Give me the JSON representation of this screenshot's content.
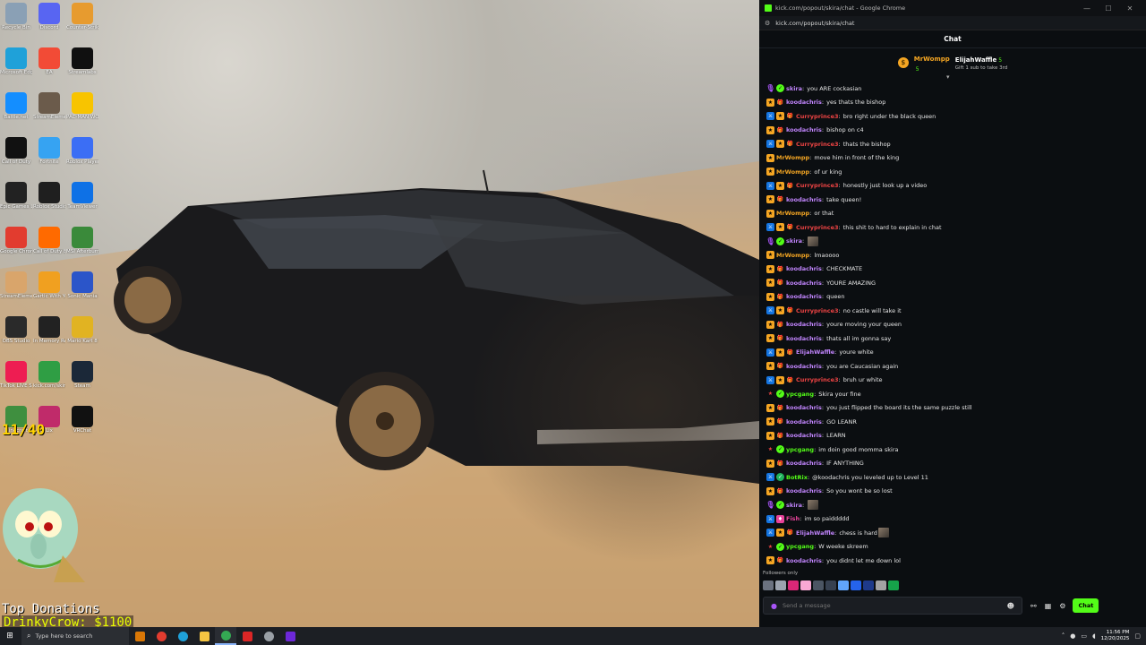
{
  "desktop": {
    "icons": [
      {
        "label": "Recycle Bin",
        "icon": "recycle-bin-icon",
        "color": "#8aa0b5"
      },
      {
        "label": "Discord",
        "icon": "discord-icon",
        "color": "#5865f2"
      },
      {
        "label": "Counter-Strike 2",
        "icon": "counter-strike-icon",
        "color": "#e79b2f"
      },
      {
        "label": "Microsoft Edge",
        "icon": "edge-icon",
        "color": "#1fa1d9"
      },
      {
        "label": "EA",
        "icon": "ea-icon",
        "color": "#f24b36"
      },
      {
        "label": "Streamlabs",
        "icon": "streamlabs-icon",
        "color": "#101010"
      },
      {
        "label": "Battle.net",
        "icon": "battlenet-icon",
        "color": "#148eff"
      },
      {
        "label": "StreamElements SE.Live",
        "icon": "streamelements-icon",
        "color": "#6b5b4b"
      },
      {
        "label": "PAC-MAN WORLD",
        "icon": "pacman-icon",
        "color": "#f8c400"
      },
      {
        "label": "Call of Duty",
        "icon": "call-of-duty-icon",
        "color": "#111111"
      },
      {
        "label": "Fortnite",
        "icon": "fortnite-icon",
        "color": "#36a3f2"
      },
      {
        "label": "Roblox Player",
        "icon": "roblox-player-icon",
        "color": "#3b6ef5"
      },
      {
        "label": "Epic Games Launcher",
        "icon": "epic-games-icon",
        "color": "#222222"
      },
      {
        "label": "Roblox Studio",
        "icon": "roblox-studio-icon",
        "color": "#1f1f1f"
      },
      {
        "label": "TeamViewer",
        "icon": "teamviewer-icon",
        "color": "#0e71e6"
      },
      {
        "label": "Google Chrome",
        "icon": "chrome-icon",
        "color": "#e23c2f"
      },
      {
        "label": "Call of Duty Black Ops III",
        "icon": "black-ops-icon",
        "color": "#ff6a00"
      },
      {
        "label": "MSI Afterburner",
        "icon": "msi-afterburner-icon",
        "color": "#3a8a3a"
      },
      {
        "label": "StreamElements SE.Live",
        "icon": "streamelements-icon",
        "color": "#d9a56b"
      },
      {
        "label": "Gartic With Your Friends",
        "icon": "gartic-icon",
        "color": "#f0a020"
      },
      {
        "label": "Sonic Mania",
        "icon": "sonic-icon",
        "color": "#2b55c9"
      },
      {
        "label": "OBS Studio",
        "icon": "obs-icon",
        "color": "#2a2a2a"
      },
      {
        "label": "In Memory Redux",
        "icon": "memory-icon",
        "color": "#222222"
      },
      {
        "label": "Mario Kart 8",
        "icon": "game-icon",
        "color": "#e1b322"
      },
      {
        "label": "TikTok LIVE Studio",
        "icon": "tiktok-icon",
        "color": "#ee1d52"
      },
      {
        "label": "kick.com/skira Chrome",
        "icon": "chrome-icon",
        "color": "#2f9e44"
      },
      {
        "label": "Steam",
        "icon": "steam-icon",
        "color": "#1b2838"
      },
      {
        "label": "Minecraft",
        "icon": "minecraft-icon",
        "color": "#3f8f3f"
      },
      {
        "label": "Lix",
        "icon": "app-icon",
        "color": "#c02b6a"
      },
      {
        "label": "VRChat",
        "icon": "vrchat-icon",
        "color": "#111111"
      }
    ],
    "counter": "11/40",
    "donations_title": "Top Donations",
    "donations_line": "DrinkyCrow: $1100"
  },
  "browser": {
    "window_title": "kick.com/popout/skira/chat - Google Chrome",
    "url": "kick.com/popout/skira/chat",
    "controls": {
      "minimize": "—",
      "maximize": "☐",
      "close": "✕"
    }
  },
  "chat": {
    "header": "Chat",
    "pinned": {
      "gifter": "MrWompp",
      "gifter_count": "5",
      "recipient": "ElijahWaffle",
      "recipient_count": "5",
      "note": "Gift 1 sub to take 3rd"
    },
    "messages": [
      {
        "badges": [
          "mic",
          "og"
        ],
        "user": "skira",
        "color": "#c084fc",
        "text": "you ARE cockasian"
      },
      {
        "badges": [
          "sub",
          "gift"
        ],
        "user": "koodachris",
        "color": "#c084fc",
        "text": "yes thats the bishop"
      },
      {
        "badges": [
          "mod",
          "sub",
          "gift"
        ],
        "user": "Curryprince3",
        "color": "#ef4444",
        "text": "bro right under the black queen"
      },
      {
        "badges": [
          "sub",
          "gift"
        ],
        "user": "koodachris",
        "color": "#c084fc",
        "text": "bishop on c4"
      },
      {
        "badges": [
          "mod",
          "sub",
          "gift"
        ],
        "user": "Curryprince3",
        "color": "#ef4444",
        "text": "thats the bishop"
      },
      {
        "badges": [
          "sub"
        ],
        "user": "MrWompp",
        "color": "#f5a623",
        "text": "move him in front of the king"
      },
      {
        "badges": [
          "sub"
        ],
        "user": "MrWompp",
        "color": "#f5a623",
        "text": "of ur king"
      },
      {
        "badges": [
          "mod",
          "sub",
          "gift"
        ],
        "user": "Curryprince3",
        "color": "#ef4444",
        "text": "honestly just look up a video"
      },
      {
        "badges": [
          "sub",
          "gift"
        ],
        "user": "koodachris",
        "color": "#c084fc",
        "text": "take queen!"
      },
      {
        "badges": [
          "sub"
        ],
        "user": "MrWompp",
        "color": "#f5a623",
        "text": "or that"
      },
      {
        "badges": [
          "mod",
          "sub",
          "gift"
        ],
        "user": "Curryprince3",
        "color": "#ef4444",
        "text": "this shit to hard to explain in chat"
      },
      {
        "badges": [
          "mic",
          "og"
        ],
        "user": "skira",
        "color": "#c084fc",
        "text": "",
        "emote": true
      },
      {
        "badges": [
          "sub"
        ],
        "user": "MrWompp",
        "color": "#f5a623",
        "text": "lmaoooo"
      },
      {
        "badges": [
          "sub",
          "gift"
        ],
        "user": "koodachris",
        "color": "#c084fc",
        "text": "CHECKMATE"
      },
      {
        "badges": [
          "sub",
          "gift"
        ],
        "user": "koodachris",
        "color": "#c084fc",
        "text": "YOURE AMAZING"
      },
      {
        "badges": [
          "sub",
          "gift"
        ],
        "user": "koodachris",
        "color": "#c084fc",
        "text": "queen"
      },
      {
        "badges": [
          "mod",
          "sub",
          "gift"
        ],
        "user": "Curryprince3",
        "color": "#ef4444",
        "text": "no castle will take it"
      },
      {
        "badges": [
          "sub",
          "gift"
        ],
        "user": "koodachris",
        "color": "#c084fc",
        "text": "youre moving your queen"
      },
      {
        "badges": [
          "sub",
          "gift"
        ],
        "user": "koodachris",
        "color": "#c084fc",
        "text": "thats all im gonna say"
      },
      {
        "badges": [
          "mod",
          "sub",
          "gift"
        ],
        "user": "ElijahWaffle",
        "color": "#c084fc",
        "text": "youre white"
      },
      {
        "badges": [
          "sub",
          "gift"
        ],
        "user": "koodachris",
        "color": "#c084fc",
        "text": "you are Caucasian again"
      },
      {
        "badges": [
          "mod",
          "sub",
          "gift"
        ],
        "user": "Curryprince3",
        "color": "#ef4444",
        "text": "bruh ur white"
      },
      {
        "badges": [
          "star",
          "og"
        ],
        "user": "ypcgang",
        "color": "#53fc18",
        "text": "Skira your fine"
      },
      {
        "badges": [
          "sub",
          "gift"
        ],
        "user": "koodachris",
        "color": "#c084fc",
        "text": "you just flipped the board its the same puzzle still"
      },
      {
        "badges": [
          "sub",
          "gift"
        ],
        "user": "koodachris",
        "color": "#c084fc",
        "text": "GO LEANR"
      },
      {
        "badges": [
          "sub",
          "gift"
        ],
        "user": "koodachris",
        "color": "#c084fc",
        "text": "LEARN"
      },
      {
        "badges": [
          "star",
          "og"
        ],
        "user": "ypcgang",
        "color": "#53fc18",
        "text": "im doin good momma skira"
      },
      {
        "badges": [
          "sub",
          "gift"
        ],
        "user": "koodachris",
        "color": "#c084fc",
        "text": "IF ANYTHING"
      },
      {
        "badges": [
          "mod",
          "bot"
        ],
        "user": "BotRix",
        "color": "#53fc18",
        "text": "@koodachris you leveled up to Level 11"
      },
      {
        "badges": [
          "sub",
          "gift"
        ],
        "user": "koodachris",
        "color": "#c084fc",
        "text": "So you wont be so lost"
      },
      {
        "badges": [
          "mic",
          "og"
        ],
        "user": "skira",
        "color": "#c084fc",
        "text": "",
        "emote": true
      },
      {
        "badges": [
          "mod",
          "vip"
        ],
        "user": "Fish",
        "color": "#e8429a",
        "text": "im so paiddddd"
      },
      {
        "badges": [
          "mod",
          "sub",
          "gift"
        ],
        "user": "ElijahWaffle",
        "color": "#c084fc",
        "text": "chess is hard",
        "emote": true
      },
      {
        "badges": [
          "star",
          "og"
        ],
        "user": "ypcgang",
        "color": "#53fc18",
        "text": "W weeke skreem"
      },
      {
        "badges": [
          "sub",
          "gift"
        ],
        "user": "koodachris",
        "color": "#c084fc",
        "text": "you didnt let me down lol"
      }
    ],
    "followers_only": "Followers only",
    "input_placeholder": "Send a message",
    "send_label": "Chat"
  },
  "taskbar": {
    "search_placeholder": "Type here to search",
    "time": "11:56 PM",
    "date": "12/20/2025"
  }
}
